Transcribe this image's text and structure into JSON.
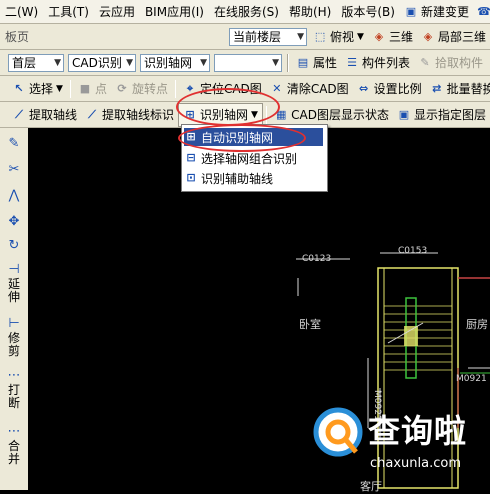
{
  "menubar": [
    "二(W)",
    "工具(T)",
    "云应用",
    "BIM应用(I)",
    "在线服务(S)",
    "帮助(H)",
    "版本号(B)",
    "新建变更",
    "联系"
  ],
  "toolbar1": {
    "left_label": "板页",
    "floor_combo": "当前楼层",
    "view_label": "俯视",
    "three_d_label": "三维",
    "local_3d_label": "局部三维"
  },
  "toolbar2": {
    "floor": "首层",
    "cad_mode": "CAD识别",
    "grid_mode": "识别轴网",
    "empty_combo": "",
    "properties": "属性",
    "component_list": "构件列表",
    "pick_component": "拾取构件"
  },
  "toolbar3": {
    "select": "选择",
    "point": "点",
    "rotate_point": "旋转点",
    "locate_cad": "定位CAD图",
    "clear_cad": "清除CAD图",
    "set_scale": "设置比例",
    "batch_replace": "批量替换"
  },
  "toolbar4": {
    "extract_axis": "提取轴线",
    "extract_axis_label": "提取轴线标识",
    "identify_grid": "识别轴网",
    "layer_display": "CAD图层显示状态",
    "show_layer": "显示指定图层"
  },
  "dropdown": {
    "items": [
      "自动识别轴网",
      "选择轴网组合识别",
      "识别辅助轴线"
    ]
  },
  "left_tools": {
    "extend": "延伸",
    "trim": "修剪",
    "break": "打断",
    "merge": "合并"
  },
  "canvas": {
    "bedroom": "卧室",
    "kitchen": "厨房",
    "living": "客厅",
    "tag1": "C0123",
    "tag2": "C0153",
    "tag3": "M0921",
    "tag4": "M0921"
  },
  "watermark": {
    "brand": "查询啦",
    "url": "chaxunla.com"
  },
  "colors": {
    "highlight": "#2b4f9c",
    "annotation_red": "#e03030",
    "cad_yellow": "#e6e66a",
    "cad_green": "#3dc23d",
    "cad_red": "#c84444",
    "cad_white": "#d8d8d8"
  }
}
